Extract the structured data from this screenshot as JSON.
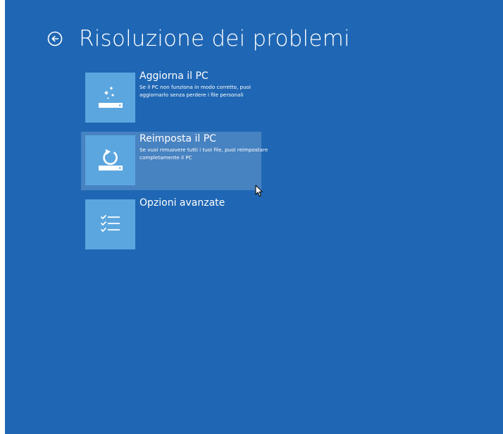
{
  "header": {
    "back_icon": "back-arrow-circle-icon",
    "title": "Risoluzione dei problemi"
  },
  "options": [
    {
      "id": "refresh",
      "icon": "refresh-pc-icon",
      "title": "Aggiorna il PC",
      "description": "Se il PC non funziona in modo corretto, puoi aggiornarlo senza perdere i file personali"
    },
    {
      "id": "reset",
      "icon": "reset-pc-icon",
      "title": "Reimposta il PC",
      "description": "Se vuoi rimuovere tutti i tuoi file, puoi reimpostare completamente il PC",
      "highlighted": true
    },
    {
      "id": "advanced",
      "icon": "checklist-icon",
      "title": "Opzioni avanzate",
      "description": ""
    }
  ],
  "colors": {
    "background": "#1f67b4",
    "tile": "#5ca6df",
    "hover": "#4c89c9",
    "text": "#ffffff"
  }
}
